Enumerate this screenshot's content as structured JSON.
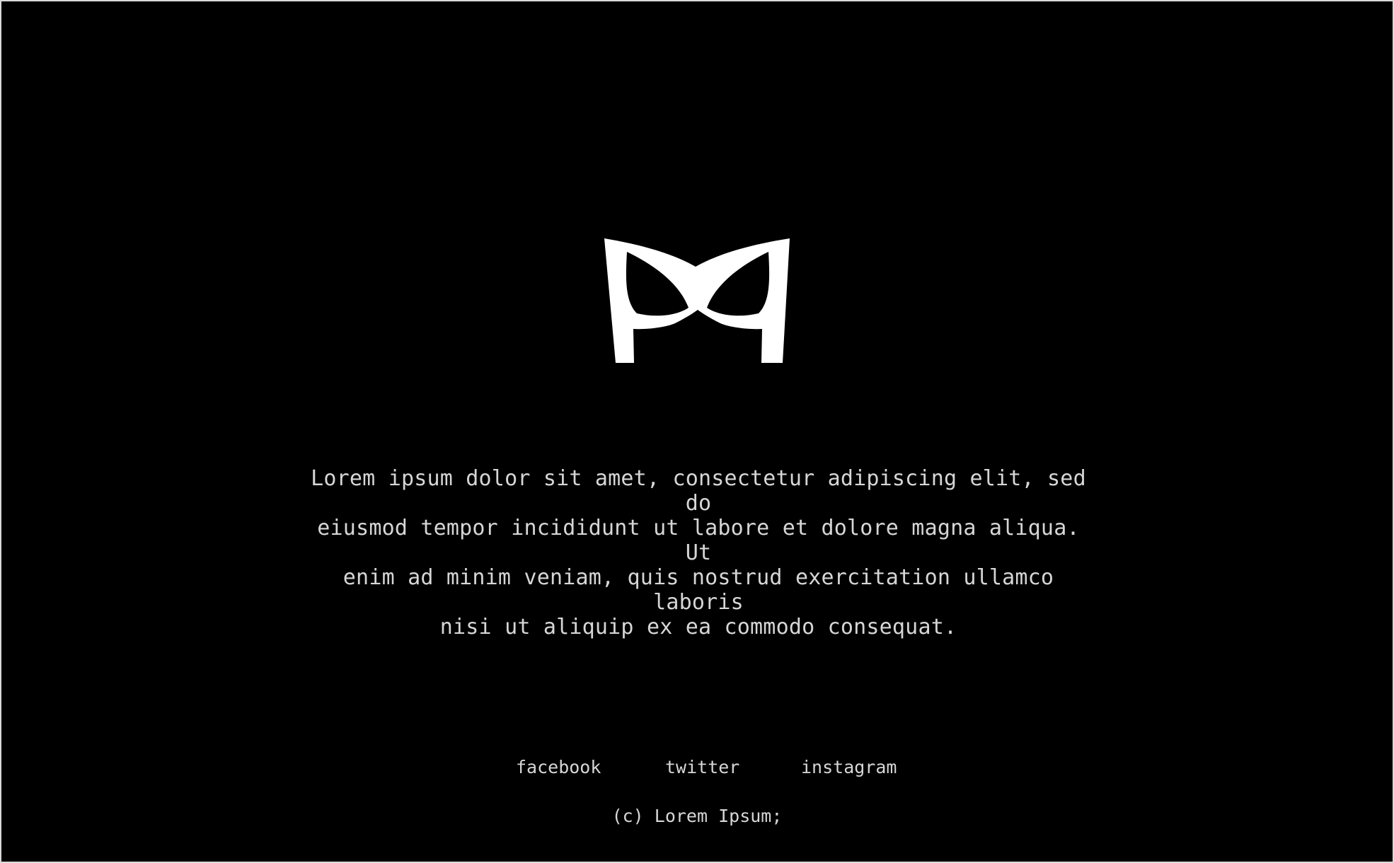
{
  "page": {
    "background_color": "#000000",
    "text_color": "#d6d6d6",
    "logo_color": "#ffffff"
  },
  "logo": {
    "icon": "mask-logo-icon"
  },
  "intro": {
    "text": "Lorem ipsum dolor sit amet, consectetur adipiscing elit, sed do\neiusmod tempor incididunt ut labore et dolore magna aliqua. Ut\nenim ad minim veniam, quis nostrud exercitation ullamco laboris\nnisi ut aliquip ex ea commodo consequat."
  },
  "social": {
    "links": [
      {
        "label": "facebook"
      },
      {
        "label": "twitter"
      },
      {
        "label": "instagram"
      }
    ]
  },
  "footer": {
    "copyright": "(c) Lorem Ipsum;"
  }
}
